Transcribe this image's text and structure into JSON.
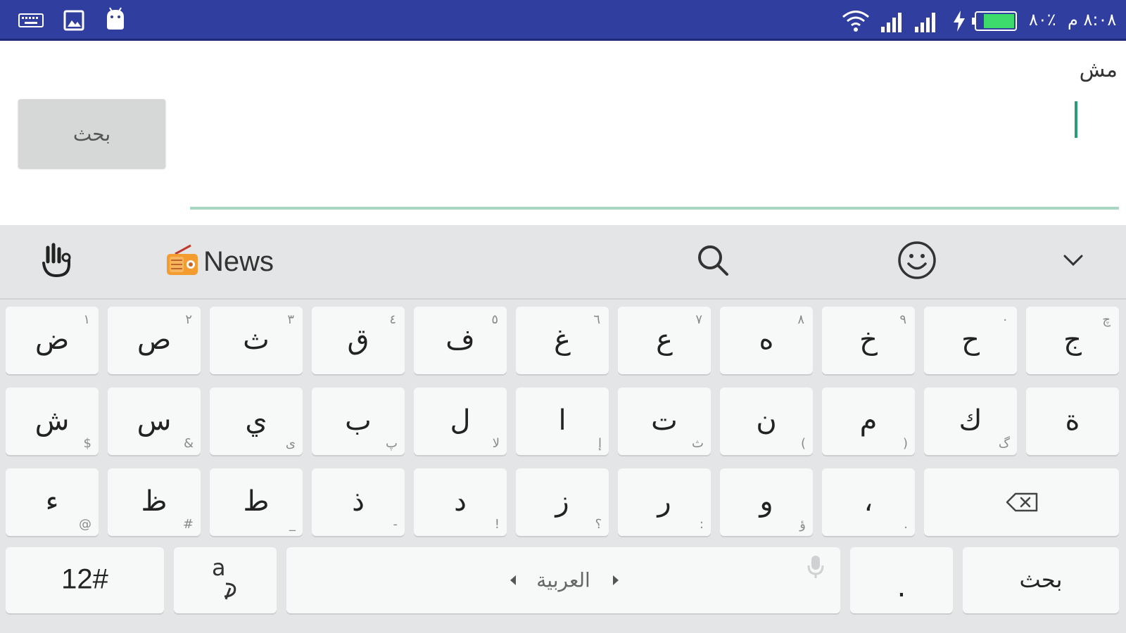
{
  "status_bar": {
    "left_icons": [
      "keyboard-icon",
      "image-icon",
      "android-icon"
    ],
    "right_icons": [
      "wifi-icon",
      "signal-icon",
      "signal-icon",
      "charging-icon",
      "battery-icon"
    ],
    "battery_percent": "٪٨٠",
    "time": "٨:٠٨ م",
    "colors": {
      "background": "#303F9F",
      "battery_fill": "#3cdb6b"
    }
  },
  "app": {
    "search_button_label": "بحث",
    "input_value": "مش",
    "colors": {
      "accent": "#2a9d75",
      "underline": "#a9d6c3"
    }
  },
  "keyboard": {
    "toolbar": {
      "news_label": "News",
      "icons": [
        "gesture-icon",
        "radio-icon",
        "search-icon",
        "emoji-icon",
        "collapse-icon"
      ]
    },
    "rows": [
      [
        {
          "main": "ض",
          "hint": "١"
        },
        {
          "main": "ص",
          "hint": "٢"
        },
        {
          "main": "ث",
          "hint": "٣"
        },
        {
          "main": "ق",
          "hint": "٤"
        },
        {
          "main": "ف",
          "hint": "٥"
        },
        {
          "main": "غ",
          "hint": "٦"
        },
        {
          "main": "ع",
          "hint": "٧"
        },
        {
          "main": "ه",
          "hint": "٨"
        },
        {
          "main": "خ",
          "hint": "٩"
        },
        {
          "main": "ح",
          "hint": "٠"
        },
        {
          "main": "ج",
          "hint": "چ"
        }
      ],
      [
        {
          "main": "ش",
          "hint": "$"
        },
        {
          "main": "س",
          "hint": "&"
        },
        {
          "main": "ي",
          "hint": "ى"
        },
        {
          "main": "ب",
          "hint": "پ"
        },
        {
          "main": "ل",
          "hint": "لا"
        },
        {
          "main": "ا",
          "hint": "إ"
        },
        {
          "main": "ت",
          "hint": "ث"
        },
        {
          "main": "ن",
          "hint": "("
        },
        {
          "main": "م",
          "hint": ")"
        },
        {
          "main": "ك",
          "hint": "گ"
        },
        {
          "main": "ة",
          "hint": ""
        }
      ],
      [
        {
          "main": "ء",
          "hint": "@"
        },
        {
          "main": "ظ",
          "hint": "#"
        },
        {
          "main": "ط",
          "hint": "_"
        },
        {
          "main": "ذ",
          "hint": "-"
        },
        {
          "main": "د",
          "hint": "!"
        },
        {
          "main": "ز",
          "hint": "؟"
        },
        {
          "main": "ر",
          "hint": ":"
        },
        {
          "main": "و",
          "hint": "ؤ"
        },
        {
          "main": "،",
          "hint": "."
        }
      ]
    ],
    "bottom": {
      "symbols_label": "12#",
      "language_label": "العربية",
      "period_label": ".",
      "action_label": "بحث"
    }
  }
}
